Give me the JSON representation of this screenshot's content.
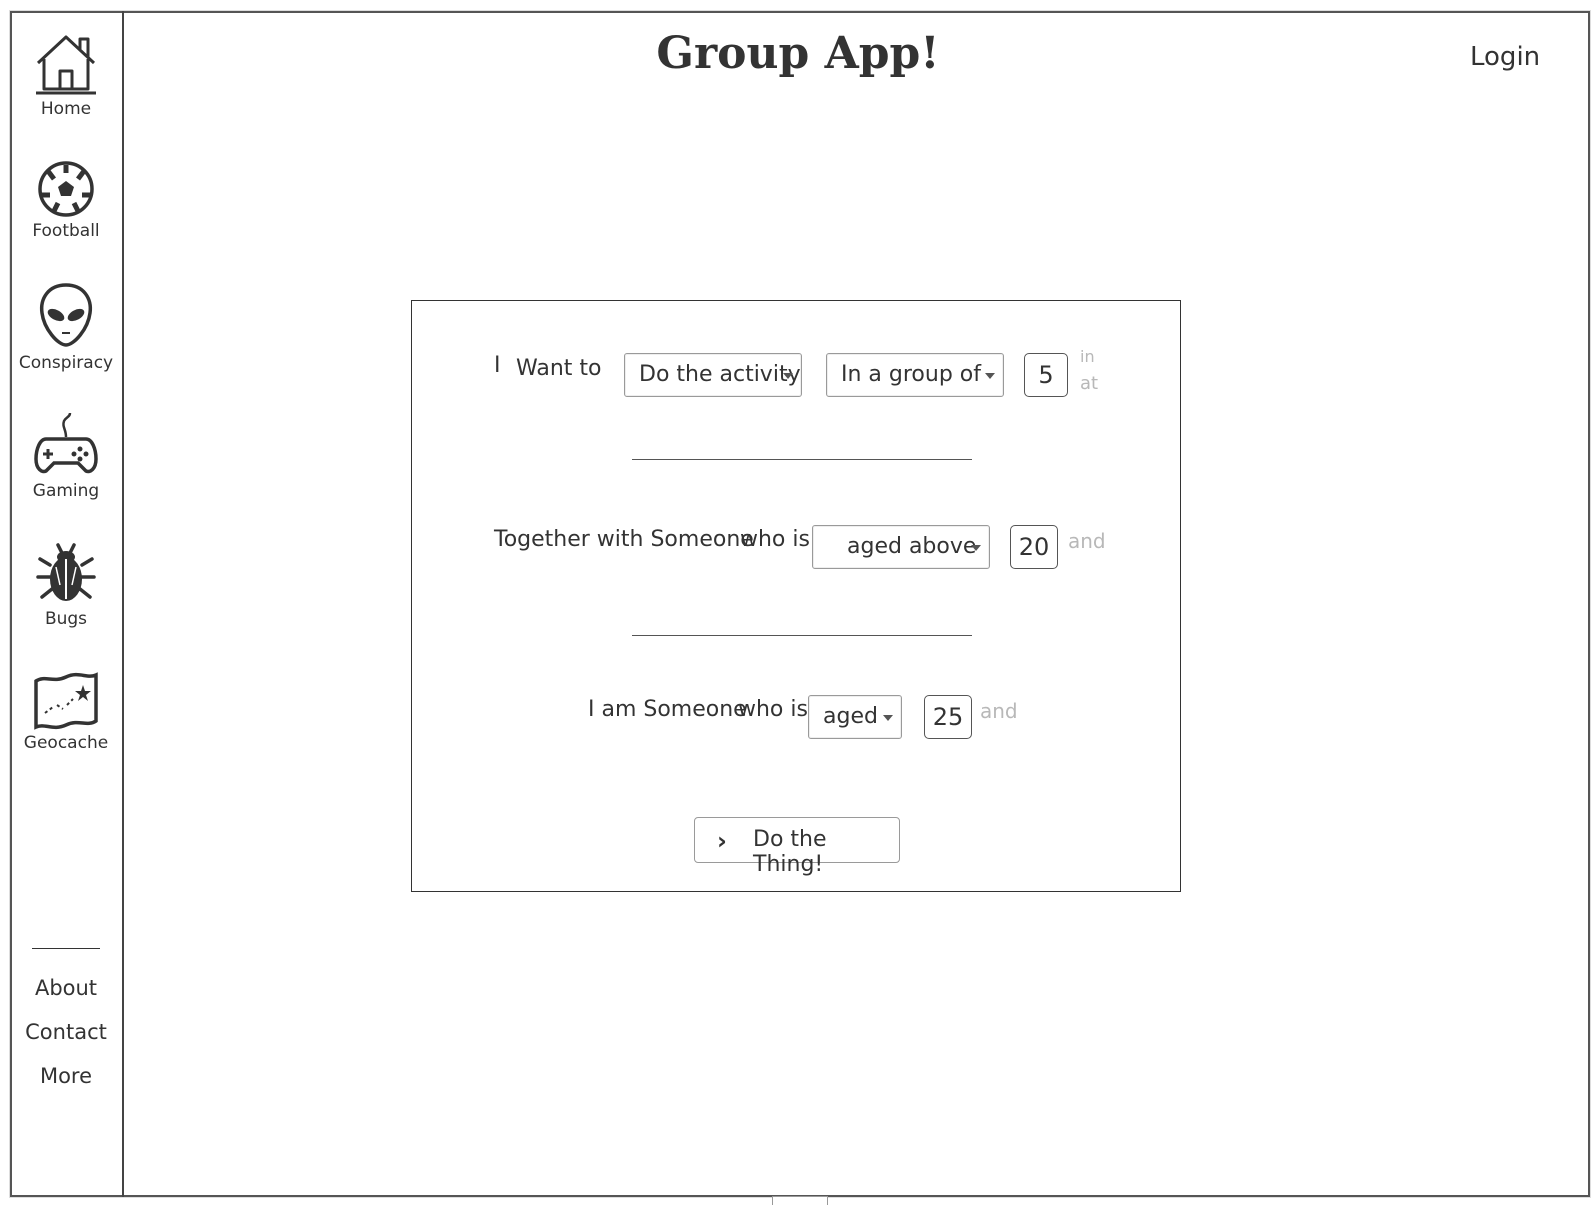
{
  "app": {
    "title": "Group App!",
    "login_label": "Login"
  },
  "sidebar": {
    "items": [
      {
        "label": "Home",
        "icon": "home-icon"
      },
      {
        "label": "Football",
        "icon": "football-icon"
      },
      {
        "label": "Conspiracy",
        "icon": "alien-icon"
      },
      {
        "label": "Gaming",
        "icon": "gamepad-icon"
      },
      {
        "label": "Bugs",
        "icon": "bug-icon"
      },
      {
        "label": "Geocache",
        "icon": "map-icon"
      }
    ],
    "footer_links": [
      "About",
      "Contact",
      "More"
    ]
  },
  "form": {
    "row1": {
      "prefix": "I",
      "want": "Want to",
      "activity_select": "Do the activity",
      "group_select": "In a group of",
      "group_size": "5",
      "hint_top": "in",
      "hint_bottom": "at"
    },
    "row2": {
      "prefix": "Together with Someone",
      "who_is": "who is",
      "age_select": "aged above",
      "age_value": "20",
      "hint": "and"
    },
    "row3": {
      "prefix": "I am Someone",
      "who_is": "who is",
      "age_select": "aged",
      "age_value": "25",
      "hint": "and"
    },
    "submit_label": "Do the Thing!"
  }
}
